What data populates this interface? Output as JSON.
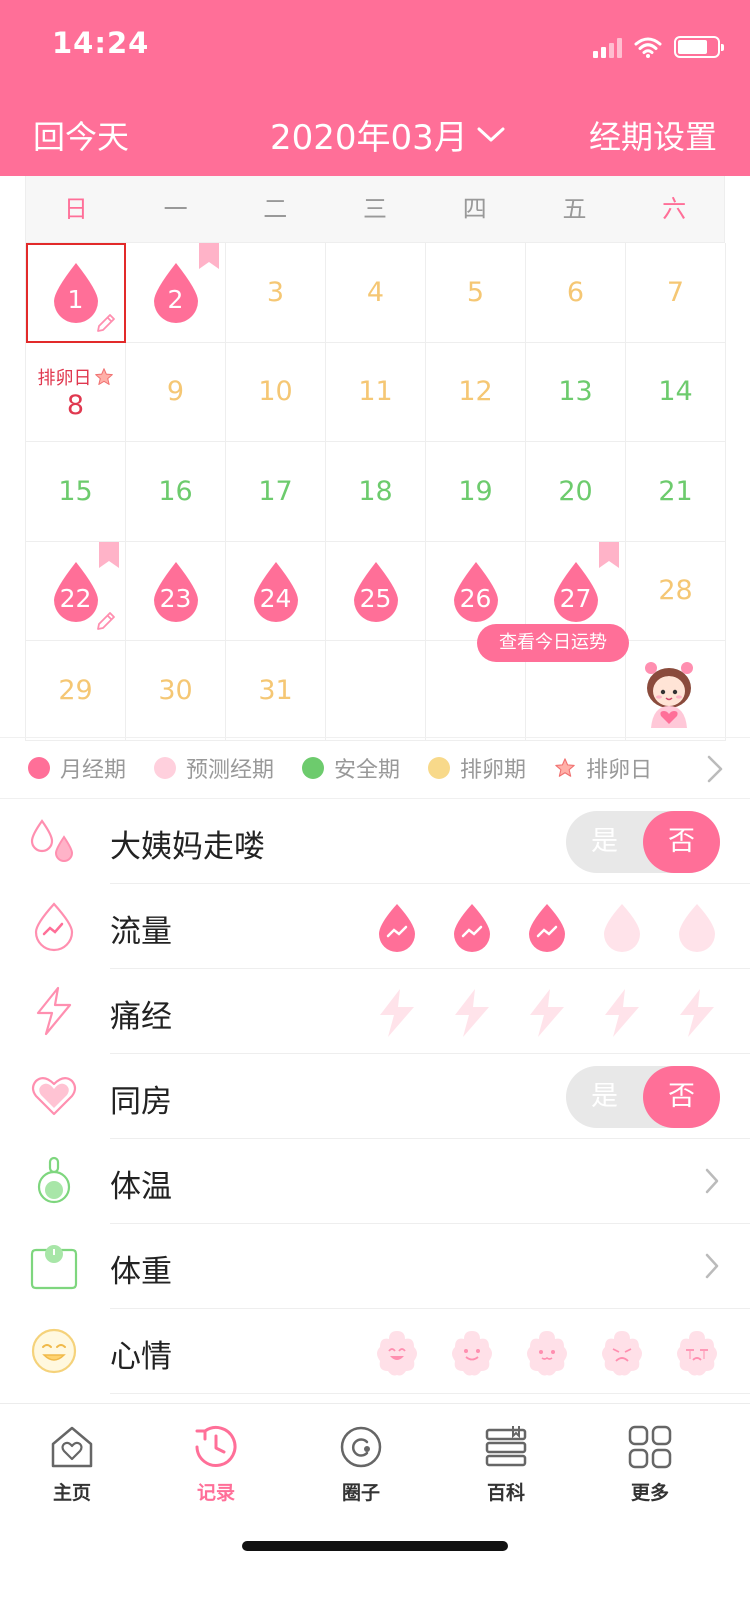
{
  "status_bar": {
    "time": "14:24"
  },
  "header": {
    "back_today": "回今天",
    "month": "2020年03月",
    "period_settings": "经期设置",
    "bg_color": "#ff6f98"
  },
  "calendar": {
    "weekdays": [
      "日",
      "一",
      "二",
      "三",
      "四",
      "五",
      "六"
    ],
    "ovulation_tag": "排卵日",
    "fortune_button": "查看今日运势",
    "days": [
      {
        "n": "1",
        "kind": "period"
      },
      {
        "n": "2",
        "kind": "period"
      },
      {
        "n": "3",
        "kind": "ovul"
      },
      {
        "n": "4",
        "kind": "ovul"
      },
      {
        "n": "5",
        "kind": "ovul"
      },
      {
        "n": "6",
        "kind": "ovul"
      },
      {
        "n": "7",
        "kind": "ovul"
      },
      {
        "n": "8",
        "kind": "ovulday"
      },
      {
        "n": "9",
        "kind": "ovul"
      },
      {
        "n": "10",
        "kind": "ovul"
      },
      {
        "n": "11",
        "kind": "ovul"
      },
      {
        "n": "12",
        "kind": "ovul"
      },
      {
        "n": "13",
        "kind": "safe"
      },
      {
        "n": "14",
        "kind": "safe"
      },
      {
        "n": "15",
        "kind": "safe"
      },
      {
        "n": "16",
        "kind": "safe"
      },
      {
        "n": "17",
        "kind": "safe"
      },
      {
        "n": "18",
        "kind": "safe"
      },
      {
        "n": "19",
        "kind": "safe"
      },
      {
        "n": "20",
        "kind": "safe"
      },
      {
        "n": "21",
        "kind": "safe"
      },
      {
        "n": "22",
        "kind": "period"
      },
      {
        "n": "23",
        "kind": "period"
      },
      {
        "n": "24",
        "kind": "period"
      },
      {
        "n": "25",
        "kind": "period"
      },
      {
        "n": "26",
        "kind": "period"
      },
      {
        "n": "27",
        "kind": "period"
      },
      {
        "n": "28",
        "kind": "ovul"
      },
      {
        "n": "29",
        "kind": "ovul"
      },
      {
        "n": "30",
        "kind": "ovul"
      },
      {
        "n": "31",
        "kind": "ovul"
      },
      {
        "n": "",
        "kind": "empty"
      },
      {
        "n": "",
        "kind": "empty"
      },
      {
        "n": "",
        "kind": "empty"
      },
      {
        "n": "",
        "kind": "empty"
      }
    ]
  },
  "legend": {
    "items": [
      {
        "label": "月经期",
        "color": "#ff6f98"
      },
      {
        "label": "预测经期",
        "color": "#ffd0dd"
      },
      {
        "label": "安全期",
        "color": "#6dcb6d"
      },
      {
        "label": "排卵期",
        "color": "#f5c774"
      },
      {
        "label": "排卵日",
        "color": "#ff8a8a"
      }
    ]
  },
  "records": {
    "period_arrived": {
      "label": "大姨妈走喽",
      "yes": "是",
      "no": "否"
    },
    "flow": {
      "label": "流量",
      "level": 3,
      "max": 5
    },
    "cramps": {
      "label": "痛经",
      "level": 0,
      "max": 5
    },
    "intimacy": {
      "label": "同房",
      "yes": "是",
      "no": "否"
    },
    "temperature": {
      "label": "体温"
    },
    "weight": {
      "label": "体重"
    },
    "mood": {
      "label": "心情"
    }
  },
  "tabbar": {
    "items": [
      {
        "label": "主页",
        "icon": "home-heart-icon"
      },
      {
        "label": "记录",
        "icon": "record-clock-icon"
      },
      {
        "label": "圈子",
        "icon": "circle-icon"
      },
      {
        "label": "百科",
        "icon": "books-icon"
      },
      {
        "label": "更多",
        "icon": "grid-icon"
      }
    ],
    "active": "记录"
  },
  "colors": {
    "accent": "#ff6f98",
    "safe": "#6dcb6d",
    "ovulation": "#f5c774",
    "today_border": "#e22a2a"
  }
}
